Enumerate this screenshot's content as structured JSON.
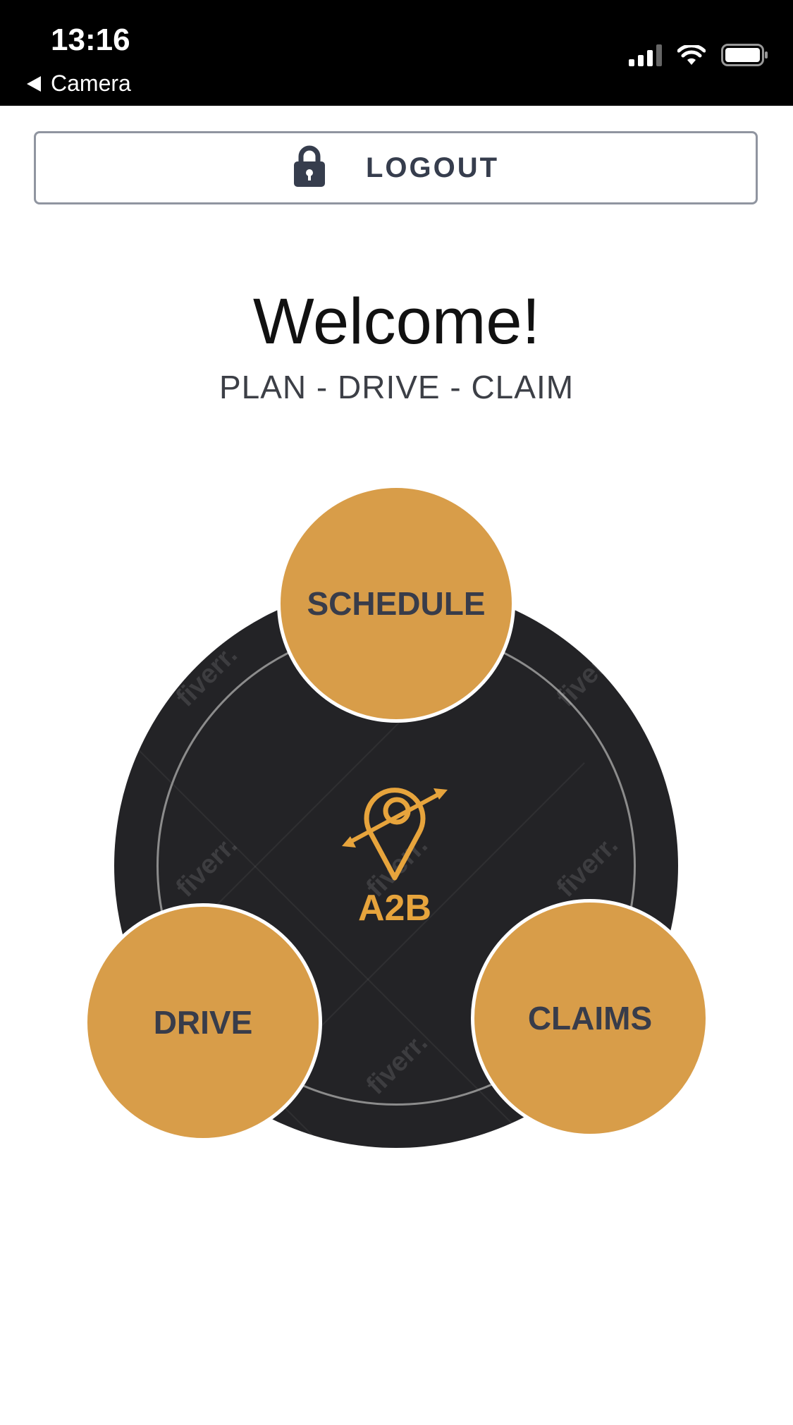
{
  "status_bar": {
    "time": "13:16",
    "back_label": "Camera"
  },
  "header": {
    "logout_label": "LOGOUT",
    "lock_icon": "lock-icon"
  },
  "welcome": {
    "title": "Welcome!",
    "tagline": "PLAN - DRIVE - CLAIM"
  },
  "logo": {
    "text": "A2B",
    "icon": "location-pin-icon"
  },
  "menu": {
    "schedule_label": "SCHEDULE",
    "drive_label": "DRIVE",
    "claims_label": "CLAIMS"
  },
  "watermark": {
    "text": "fiverr."
  },
  "colors": {
    "accent": "#d89d49",
    "dark": "#232326",
    "logo": "#e7a43c",
    "text": "#363d4d"
  }
}
